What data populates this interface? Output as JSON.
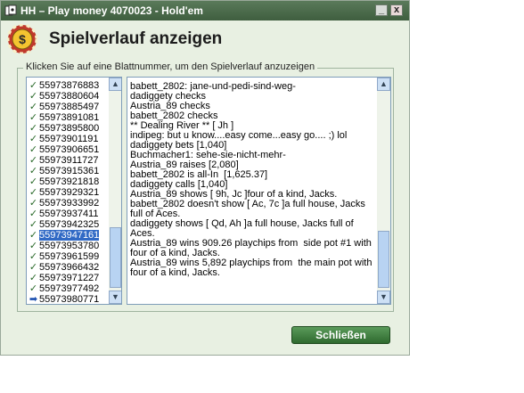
{
  "window": {
    "title": "HH – Play money 4070023 - Hold'em",
    "minimize_glyph": "_",
    "close_glyph": "x"
  },
  "header": {
    "title": "Spielverlauf anzeigen",
    "logo_glyph": "$"
  },
  "group": {
    "label": "Klicken Sie auf eine Blattnummer, um den Spielverlauf anzuzeigen"
  },
  "hands": [
    {
      "number": "55973876883",
      "mark": "✓",
      "state": "viewed"
    },
    {
      "number": "55973880604",
      "mark": "✓",
      "state": "viewed"
    },
    {
      "number": "55973885497",
      "mark": "✓",
      "state": "viewed"
    },
    {
      "number": "55973891081",
      "mark": "✓",
      "state": "viewed"
    },
    {
      "number": "55973895800",
      "mark": "✓",
      "state": "viewed"
    },
    {
      "number": "55973901191",
      "mark": "✓",
      "state": "viewed"
    },
    {
      "number": "55973906651",
      "mark": "✓",
      "state": "viewed"
    },
    {
      "number": "55973911727",
      "mark": "✓",
      "state": "viewed"
    },
    {
      "number": "55973915361",
      "mark": "✓",
      "state": "viewed"
    },
    {
      "number": "55973921818",
      "mark": "✓",
      "state": "viewed"
    },
    {
      "number": "55973929321",
      "mark": "✓",
      "state": "viewed"
    },
    {
      "number": "55973933992",
      "mark": "✓",
      "state": "viewed"
    },
    {
      "number": "55973937411",
      "mark": "✓",
      "state": "viewed"
    },
    {
      "number": "55973942325",
      "mark": "✓",
      "state": "viewed"
    },
    {
      "number": "55973947161",
      "mark": "✓",
      "state": "selected"
    },
    {
      "number": "55973953780",
      "mark": "✓",
      "state": "viewed"
    },
    {
      "number": "55973961599",
      "mark": "✓",
      "state": "viewed"
    },
    {
      "number": "55973966432",
      "mark": "✓",
      "state": "viewed"
    },
    {
      "number": "55973971227",
      "mark": "✓",
      "state": "viewed"
    },
    {
      "number": "55973977492",
      "mark": "✓",
      "state": "viewed"
    },
    {
      "number": "55973980771",
      "mark": "➡",
      "state": "current"
    }
  ],
  "history_lines": [
    "babett_2802: jane-und-pedi-sind-weg-",
    "dadiggety checks",
    "Austria_89 checks",
    "babett_2802 checks",
    "** Dealing River ** [ Jh ]",
    "indipeg: but u know....easy come...easy go.... ;) lol",
    "dadiggety bets [1,040]",
    "Buchmacher1: sehe-sie-nicht-mehr-",
    "Austria_89 raises [2,080]",
    "babett_2802 is all-In  [1,625.37]",
    "dadiggety calls [1,040]",
    "Austria_89 shows [ 9h, Jc ]four of a kind, Jacks.",
    "babett_2802 doesn't show [ Ac, 7c ]a full house, Jacks full of Aces.",
    "dadiggety shows [ Qd, Ah ]a full house, Jacks full of Aces.",
    "Austria_89 wins 909.26 playchips from  side pot #1 with four of a kind, Jacks.",
    "Austria_89 wins 5,892 playchips from  the main pot with four of a kind, Jacks."
  ],
  "scroll_glyphs": {
    "up": "▲",
    "down": "▼"
  },
  "close_button": "Schließen",
  "colors": {
    "title_bar": "#4a6b4a",
    "selection": "#316ac5",
    "button": "#3f7f3f"
  }
}
